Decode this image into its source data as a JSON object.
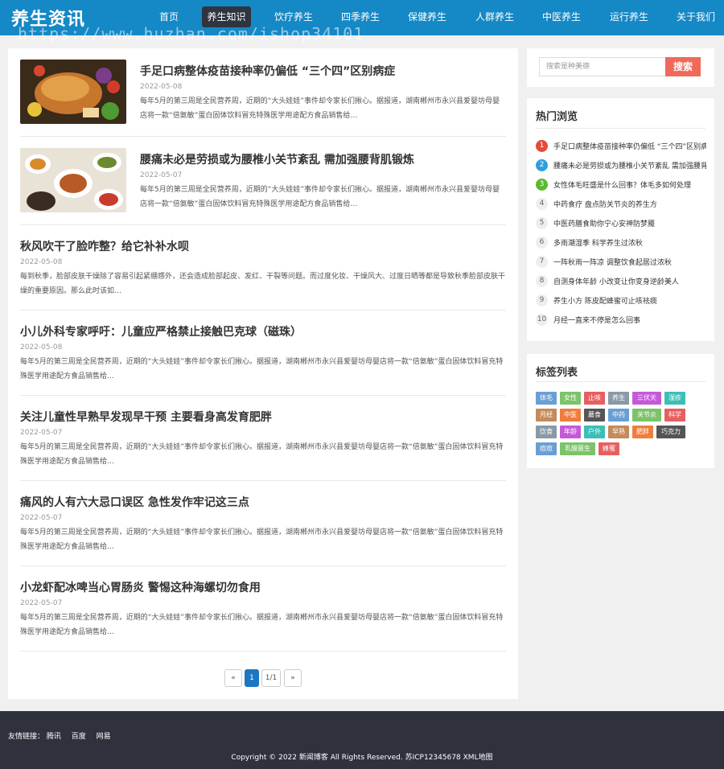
{
  "header": {
    "logo": "养生资讯",
    "watermark": "https://www.huzhan.com/ishop34101",
    "nav": [
      {
        "label": "首页"
      },
      {
        "label": "养生知识"
      },
      {
        "label": "饮疗养生"
      },
      {
        "label": "四季养生"
      },
      {
        "label": "保健养生"
      },
      {
        "label": "人群养生"
      },
      {
        "label": "中医养生"
      },
      {
        "label": "运行养生"
      },
      {
        "label": "关于我们"
      }
    ],
    "active_index": 1
  },
  "articles": [
    {
      "title": "手足口病整体疫苗接种率仍偏低 “三个四”区别病症",
      "date": "2022-05-08",
      "desc": "每年5月的第三周是全民营养周，近期的“大头娃娃”事件却令家长们揪心。据报道，湖南郴州市永兴县爱婴坊母婴店将一款“倍氨敏”蛋白固体饮料冒充特殊医学用途配方食品销售给…",
      "has_thumb": true,
      "thumb": "food-platter"
    },
    {
      "title": "腰痛未必是劳损或为腰椎小关节紊乱 需加强腰背肌锻炼",
      "date": "2022-05-07",
      "desc": "每年5月的第三周是全民营养周，近期的“大头娃娃”事件却令家长们揪心。据报道，湖南郴州市永兴县爱婴坊母婴店将一款“倍氨敏”蛋白固体饮料冒充特殊医学用途配方食品销售给…",
      "has_thumb": true,
      "thumb": "dishes"
    },
    {
      "title": "秋风吹干了脸咋整？给它补补水呗",
      "date": "2022-05-08",
      "desc": "每到秋季，脸部皮肤干燥除了容易引起紧绷感外，还会造成脸部起皮、发红、干裂等问题。而过度化妆、干燥风大、过度日晒等都是导致秋季脸部皮肤干燥的重要原因。那么此时该如…",
      "has_thumb": false
    },
    {
      "title": "小儿外科专家呼吁：儿童应严格禁止接触巴克球（磁珠）",
      "date": "2022-05-08",
      "desc": "每年5月的第三周是全民营养周，近期的“大头娃娃”事件却令家长们揪心。据报道，湖南郴州市永兴县爱婴坊母婴店将一款“倍氨敏”蛋白固体饮料冒充特殊医学用途配方食品销售给…",
      "has_thumb": false
    },
    {
      "title": "关注儿童性早熟早发现早干预 主要看身高发育肥胖",
      "date": "2022-05-07",
      "desc": "每年5月的第三周是全民营养周，近期的“大头娃娃”事件却令家长们揪心。据报道，湖南郴州市永兴县爱婴坊母婴店将一款“倍氨敏”蛋白固体饮料冒充特殊医学用途配方食品销售给…",
      "has_thumb": false
    },
    {
      "title": "痛风的人有六大忌口误区 急性发作牢记这三点",
      "date": "2022-05-07",
      "desc": "每年5月的第三周是全民营养周，近期的“大头娃娃”事件却令家长们揪心。据报道，湖南郴州市永兴县爱婴坊母婴店将一款“倍氨敏”蛋白固体饮料冒充特殊医学用途配方食品销售给…",
      "has_thumb": false
    },
    {
      "title": "小龙虾配冰啤当心胃肠炎 警惕这种海螺切勿食用",
      "date": "2022-05-07",
      "desc": "每年5月的第三周是全民营养周，近期的“大头娃娃”事件却令家长们揪心。据报道，湖南郴州市永兴县爱婴坊母婴店将一款“倍氨敏”蛋白固体饮料冒充特殊医学用途配方食品销售给…",
      "has_thumb": false
    }
  ],
  "pagination": {
    "prev": "«",
    "current": "1",
    "info": "1/1",
    "next": "»"
  },
  "search": {
    "placeholder": "搜索是种美德",
    "button": "搜索"
  },
  "hot": {
    "title": "热门浏览",
    "items": [
      {
        "num": "1",
        "text": "手足口病整体疫苗接种率仍偏低 “三个四”区别病症",
        "color": "#e64a3b"
      },
      {
        "num": "2",
        "text": "腰痛未必是劳损或为腰椎小关节紊乱 需加强腰背肌锻炼",
        "color": "#2e9fde"
      },
      {
        "num": "3",
        "text": "女性体毛旺盛是什么回事？体毛多如何处理",
        "color": "#5cb82e"
      },
      {
        "num": "4",
        "text": "中药食疗 盘点防关节炎的养生方"
      },
      {
        "num": "5",
        "text": "中医药膳食助你宁心安神防梦魇"
      },
      {
        "num": "6",
        "text": "多雨潮湿季 科学养生过浓秋"
      },
      {
        "num": "7",
        "text": "一阵秋雨一阵凉 调整饮食起居过浓秋"
      },
      {
        "num": "8",
        "text": "自测身体年龄 小改变让你变身逆龄美人"
      },
      {
        "num": "9",
        "text": "养生小方 陈皮配蜂蜜可止咳祛痰"
      },
      {
        "num": "10",
        "text": "月经一直来不停是怎么回事"
      }
    ]
  },
  "tags": {
    "title": "标签列表",
    "items": [
      {
        "label": "体毛",
        "color": "#6a9fd4"
      },
      {
        "label": "女性",
        "color": "#7cc36a"
      },
      {
        "label": "止咳",
        "color": "#e66060"
      },
      {
        "label": "养生",
        "color": "#8a9aa6"
      },
      {
        "label": "三伏天",
        "color": "#c55ad8"
      },
      {
        "label": "湿疹",
        "color": "#3bbfb6"
      },
      {
        "label": "月经",
        "color": "#c48a5a"
      },
      {
        "label": "中医",
        "color": "#f07d3c"
      },
      {
        "label": "蘑食",
        "color": "#555555"
      },
      {
        "label": "中药",
        "color": "#6a9fd4"
      },
      {
        "label": "关节炎",
        "color": "#7cc36a"
      },
      {
        "label": "科学",
        "color": "#e66060"
      },
      {
        "label": "饮食",
        "color": "#8a9aa6"
      },
      {
        "label": "年龄",
        "color": "#c55ad8"
      },
      {
        "label": "户外",
        "color": "#3bbfb6"
      },
      {
        "label": "早熟",
        "color": "#c48a5a"
      },
      {
        "label": "肥胖",
        "color": "#f07d3c"
      },
      {
        "label": "巧克力",
        "color": "#555555"
      },
      {
        "label": "痘痘",
        "color": "#6a9fd4"
      },
      {
        "label": "乳酸菌生",
        "color": "#7cc36a"
      },
      {
        "label": "蜂蜜",
        "color": "#e66060"
      }
    ]
  },
  "footer": {
    "friend_label": "友情链接：",
    "links": [
      "腾讯",
      "百度",
      "网易"
    ],
    "copyright": "Copyright © 2022 新闻博客 All Rights Reserved. 苏ICP12345678  XML地图"
  }
}
